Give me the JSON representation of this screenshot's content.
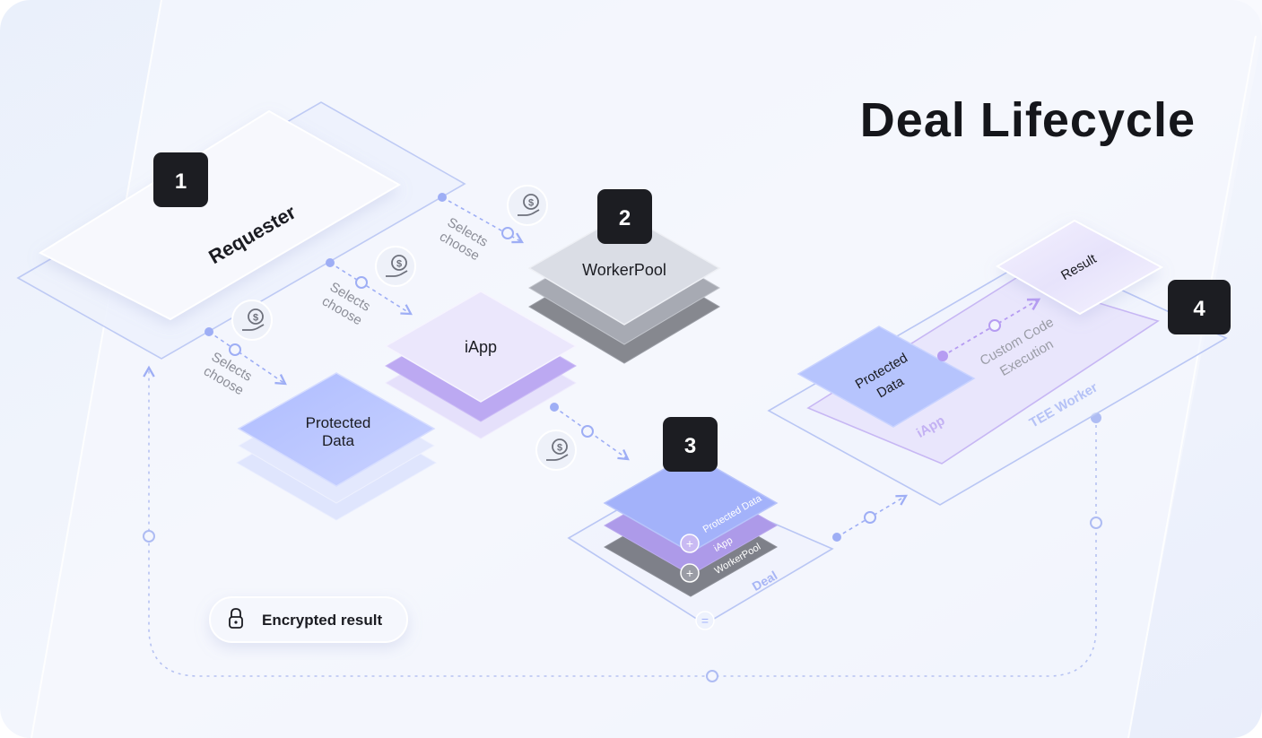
{
  "title": "Deal Lifecycle",
  "steps": {
    "s1": "1",
    "s2": "2",
    "s3": "3",
    "s4": "4"
  },
  "nodes": {
    "requester": "Requester",
    "workerpool": "WorkerPool",
    "iapp": "iApp",
    "protected_data_line1": "Protected",
    "protected_data_line2": "Data"
  },
  "edges": {
    "selects": "Selects",
    "choose": "choose"
  },
  "deal": {
    "label": "Deal",
    "layer_protected_data": "Protected Data",
    "layer_iapp": "iApp",
    "layer_workerpool": "WorkerPool",
    "plus": "+",
    "equals": "="
  },
  "tee": {
    "worker_label": "TEE Worker",
    "iapp_label": "iApp",
    "protected_line1": "Protected",
    "protected_line2": "Data",
    "execution_line1": "Custom Code",
    "execution_line2": "Execution",
    "result": "Result"
  },
  "legend": {
    "encrypted_result": "Encrypted result",
    "icon": "lock-icon"
  },
  "icons": {
    "payment": "hand-coin-icon"
  },
  "colors": {
    "badge_bg": "#1c1d22",
    "title": "#15161b",
    "accent_blue": "#8ea3f5",
    "accent_purple": "#b69cf2",
    "workerpool_grey": "#7f828d",
    "dotted_line": "#b6c2f2"
  }
}
